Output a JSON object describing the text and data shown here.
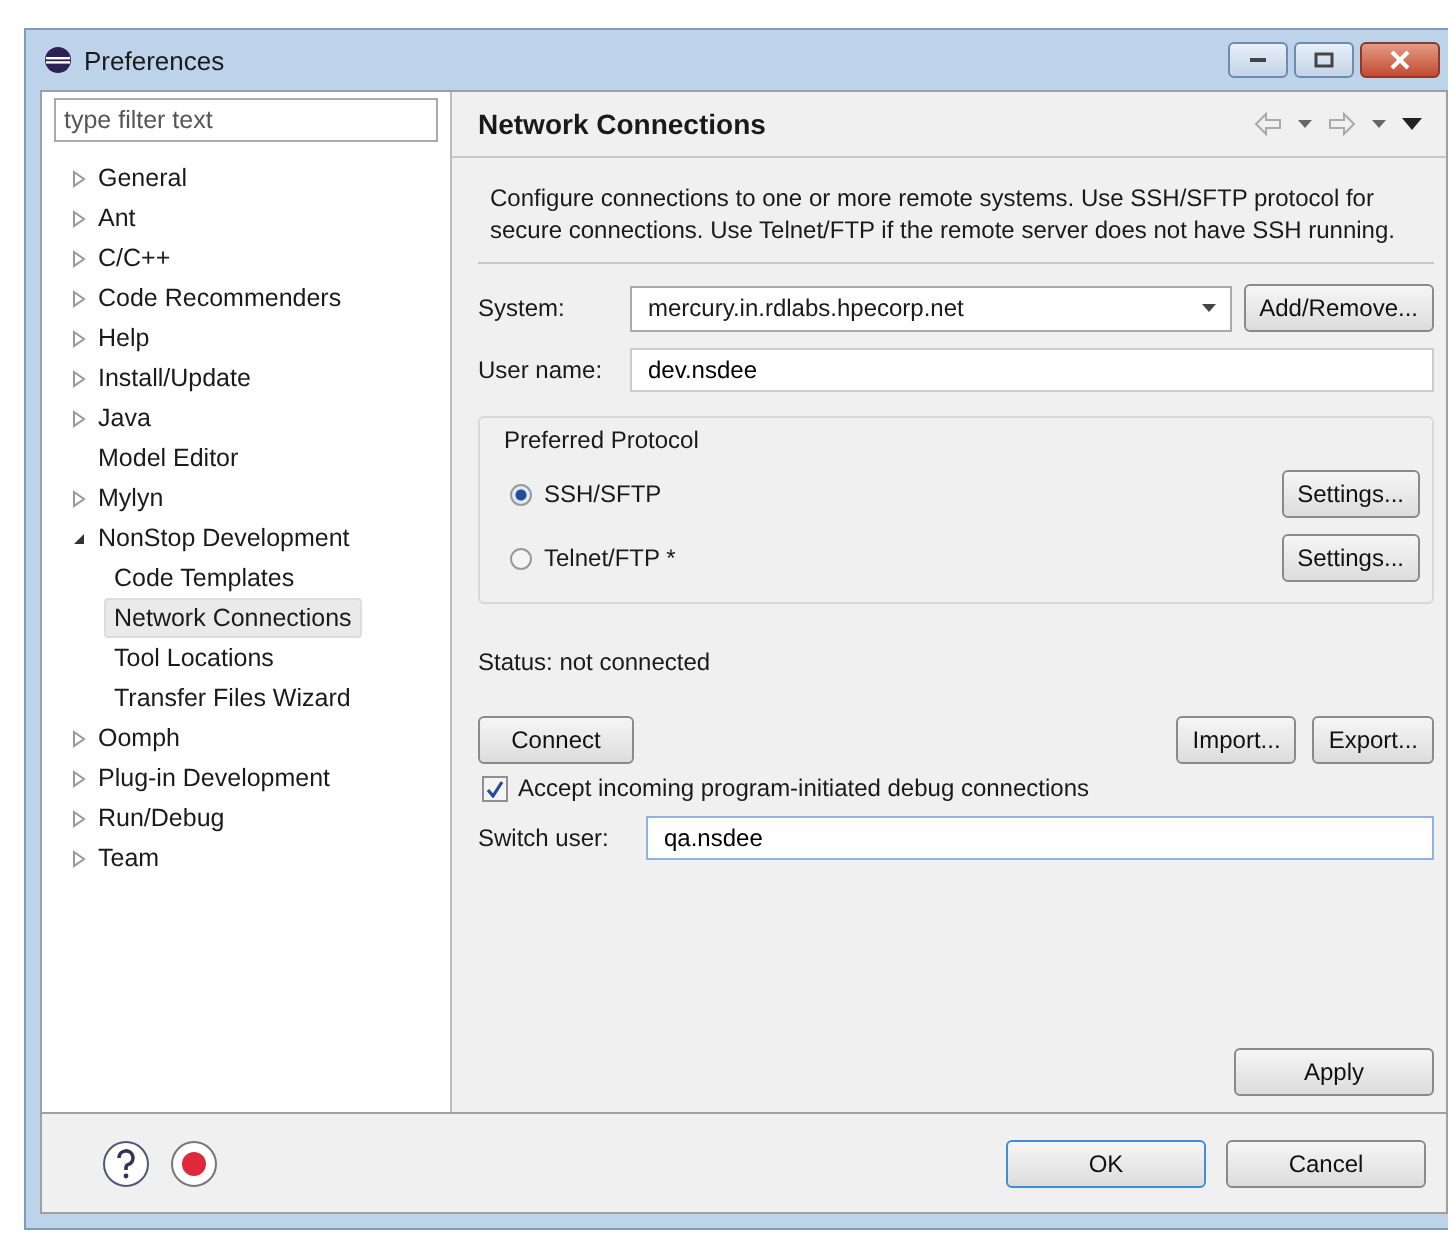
{
  "window": {
    "title": "Preferences"
  },
  "filter": {
    "placeholder": "type filter text"
  },
  "tree": [
    {
      "label": "General",
      "expanded": false,
      "selected": false
    },
    {
      "label": "Ant",
      "expanded": false,
      "selected": false
    },
    {
      "label": "C/C++",
      "expanded": false,
      "selected": false
    },
    {
      "label": "Code Recommenders",
      "expanded": false,
      "selected": false
    },
    {
      "label": "Help",
      "expanded": false,
      "selected": false
    },
    {
      "label": "Install/Update",
      "expanded": false,
      "selected": false
    },
    {
      "label": "Java",
      "expanded": false,
      "selected": false
    },
    {
      "label": "Model Editor",
      "selected": false
    },
    {
      "label": "Mylyn",
      "expanded": false,
      "selected": false
    },
    {
      "label": "NonStop Development",
      "expanded": true,
      "selected": false,
      "children": [
        {
          "label": "Code Templates",
          "selected": false
        },
        {
          "label": "Network Connections",
          "selected": true
        },
        {
          "label": "Tool Locations",
          "selected": false
        },
        {
          "label": "Transfer Files Wizard",
          "selected": false
        }
      ]
    },
    {
      "label": "Oomph",
      "expanded": false,
      "selected": false
    },
    {
      "label": "Plug-in Development",
      "expanded": false,
      "selected": false
    },
    {
      "label": "Run/Debug",
      "expanded": false,
      "selected": false
    },
    {
      "label": "Team",
      "expanded": false,
      "selected": false
    }
  ],
  "page": {
    "title": "Network Connections",
    "description": "Configure connections to one or more remote systems. Use SSH/SFTP protocol for secure connections. Use Telnet/FTP if the remote server does not have SSH running.",
    "system": {
      "label": "System:",
      "value": "mercury.in.rdlabs.hpecorp.net",
      "button": "Add/Remove..."
    },
    "user_name": {
      "label": "User name:",
      "value": "dev.nsdee"
    },
    "protocol": {
      "title": "Preferred Protocol",
      "options": [
        {
          "label": "SSH/SFTP",
          "selected": true,
          "button": "Settings..."
        },
        {
          "label": "Telnet/FTP *",
          "selected": false,
          "button": "Settings..."
        }
      ]
    },
    "status": "Status: not connected",
    "connect_button": "Connect",
    "import_button": "Import...",
    "export_button": "Export...",
    "accept": {
      "label": "Accept incoming program-initiated debug connections",
      "checked": true
    },
    "switch_user": {
      "label": "Switch user:",
      "value": "qa.nsdee"
    },
    "apply_button": "Apply"
  },
  "buttons": [
    "OK",
    "Cancel"
  ]
}
